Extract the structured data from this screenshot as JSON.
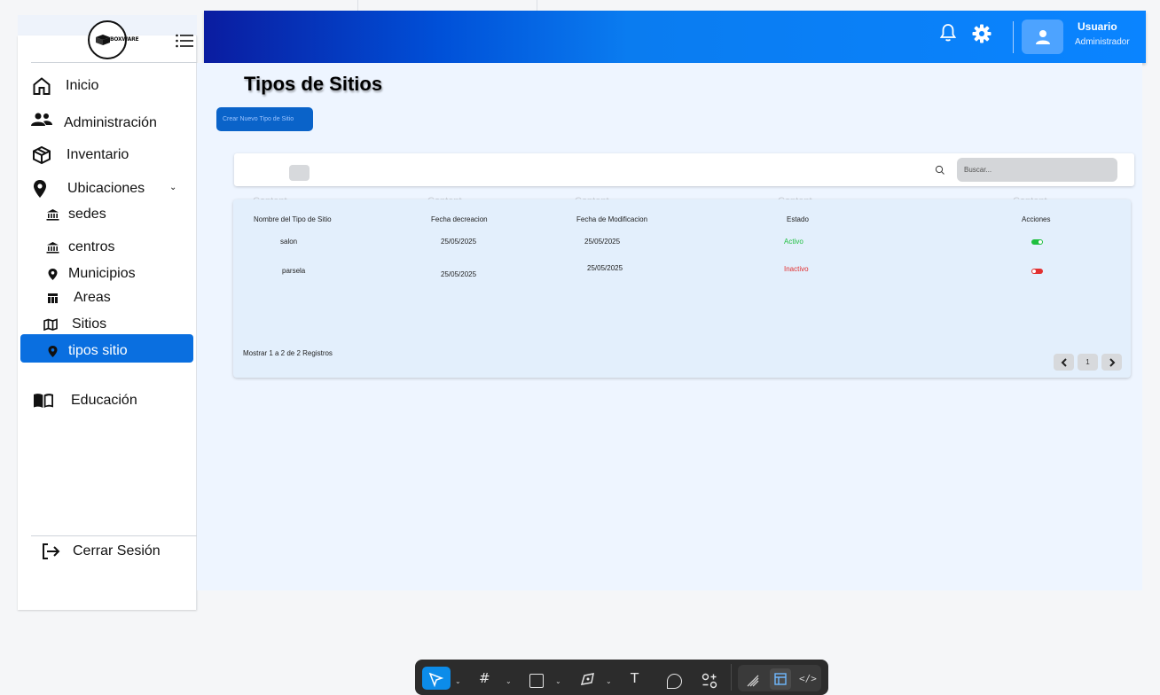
{
  "app": {
    "logo_text": "BOXWARE"
  },
  "header": {
    "user_name": "Usuario",
    "user_role": "Administrador"
  },
  "sidebar": {
    "items": [
      {
        "label": "Inicio",
        "icon": "home-icon"
      },
      {
        "label": "Administración",
        "icon": "people-icon"
      },
      {
        "label": "Inventario",
        "icon": "box-icon"
      },
      {
        "label": "Ubicaciones",
        "icon": "location-pin-icon",
        "expanded": true
      }
    ],
    "sub_items": [
      {
        "label": "sedes",
        "icon": "bank-icon"
      },
      {
        "label": "centros",
        "icon": "bank-icon"
      },
      {
        "label": "Municipios",
        "icon": "location-pin-icon"
      },
      {
        "label": "Areas",
        "icon": "table-icon"
      },
      {
        "label": "Sitios",
        "icon": "map-icon"
      },
      {
        "label": "tipos sitio",
        "icon": "location-pin-icon",
        "active": true
      }
    ],
    "education": {
      "label": "Educación",
      "icon": "book-icon"
    },
    "logout": {
      "label": "Cerrar Sesión",
      "icon": "logout-icon"
    }
  },
  "page": {
    "title": "Tipos de  Sitios",
    "create_button": "Crear Nuevo Tipo de Sitio",
    "search_placeholder": "Buscar..."
  },
  "table": {
    "ghost_labels": [
      "Content",
      "Content",
      "Content",
      "Content",
      "Content"
    ],
    "headers": [
      "Nombre del Tipo de Sitio",
      "Fecha decreacion",
      "Fecha de Modificacion",
      "Estado",
      "Acciones"
    ],
    "rows": [
      {
        "nombre": "salon",
        "fecha_creacion": "25/05/2025",
        "fecha_modificacion": "25/05/2025",
        "estado": "Activo",
        "toggle_on": true
      },
      {
        "nombre": "parsela",
        "fecha_creacion": "25/05/2025",
        "fecha_modificacion": "25/05/2025",
        "estado": "Inactivo",
        "toggle_on": false
      }
    ],
    "records_text": "Mostrar 1 a 2 de 2 Registros",
    "pagination": {
      "current_page": "1",
      "prev_icon": "chevron-left-icon",
      "next_icon": "chevron-right-icon"
    }
  },
  "colors": {
    "accent": "#0a6fe0",
    "active_status": "#1fbf3f",
    "inactive_status": "#e23030",
    "header_start": "#0a1ca0",
    "header_end": "#0a84ff"
  },
  "toolbar": {
    "tools": [
      "move-tool-icon",
      "frame-tool-icon",
      "rectangle-tool-icon",
      "pen-tool-icon",
      "text-tool-icon",
      "comment-tool-icon",
      "actions-tool-icon",
      "draw-mode-icon",
      "design-mode-icon",
      "dev-mode-icon"
    ],
    "text_tool_glyph": "T"
  }
}
